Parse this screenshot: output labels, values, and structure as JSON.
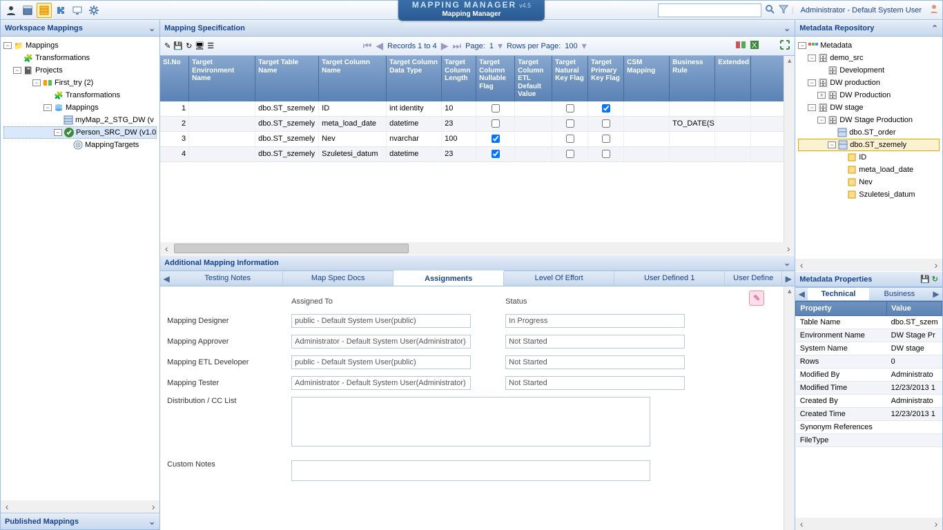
{
  "app": {
    "title_line1": "MAPPING MANAGER",
    "title_line2": "Mapping Manager",
    "version": "v4.5"
  },
  "user": {
    "label": "Administrator - Default System User"
  },
  "left": {
    "header": "Workspace Mappings",
    "footer": "Published Mappings",
    "tree": {
      "root": "Mappings",
      "transformations": "Transformations",
      "projects": "Projects",
      "first_try": "First_try (2)",
      "transformations2": "Transformations",
      "mappings2": "Mappings",
      "map1": "myMap_2_STG_DW (v",
      "map2": "Person_SRC_DW (v1.0",
      "targets": "MappingTargets"
    }
  },
  "center": {
    "header": "Mapping Specification",
    "records": "Records 1 to 4",
    "page_label": "Page:",
    "page": "1",
    "rpp_label": "Rows per Page:",
    "rpp": "100",
    "cols": {
      "slno": "Sl.No",
      "env": "Target Environment Name",
      "table": "Target Table Name",
      "column": "Target Column Name",
      "dtype": "Target Column Data Type",
      "len": "Target Column Length",
      "nullable": "Target Column Nullable Flag",
      "etldef": "Target Column ETL Default Value",
      "natkey": "Target Natural Key Flag",
      "pk": "Target Primary Key Flag",
      "csm": "CSM Mapping",
      "brule": "Business Rule",
      "ext": "Extended Business Transfor"
    },
    "rows": [
      {
        "sl": "1",
        "table": "dbo.ST_szemely",
        "col": "ID",
        "dt": "int identity",
        "len": "10",
        "null": false,
        "nat": false,
        "pk": true,
        "br": ""
      },
      {
        "sl": "2",
        "table": "dbo.ST_szemely",
        "col": "meta_load_date",
        "dt": "datetime",
        "len": "23",
        "null": false,
        "nat": false,
        "pk": false,
        "br": "TO_DATE(SY"
      },
      {
        "sl": "3",
        "table": "dbo.ST_szemely",
        "col": "Nev",
        "dt": "nvarchar",
        "len": "100",
        "null": true,
        "nat": false,
        "pk": false,
        "br": ""
      },
      {
        "sl": "4",
        "table": "dbo.ST_szemely",
        "col": "Szuletesi_datum",
        "dt": "datetime",
        "len": "23",
        "null": true,
        "nat": false,
        "pk": false,
        "br": ""
      }
    ]
  },
  "lower": {
    "header": "Additional Mapping Information",
    "tabs": {
      "testing": "Testing Notes",
      "spec": "Map Spec Docs",
      "assign": "Assignments",
      "loe": "Level Of Effort",
      "ud1": "User Defined 1",
      "udx": "User Define"
    },
    "assign": {
      "hdr1": "Assigned To",
      "hdr2": "Status",
      "rows": {
        "designer": {
          "lbl": "Mapping Designer",
          "who": "public - Default System User(public)",
          "st": "In Progress"
        },
        "approver": {
          "lbl": "Mapping Approver",
          "who": "Administrator - Default System User(Administrator)",
          "st": "Not Started"
        },
        "etl": {
          "lbl": "Mapping ETL Developer",
          "who": "public - Default System User(public)",
          "st": "Not Started"
        },
        "tester": {
          "lbl": "Mapping Tester",
          "who": "Administrator - Default System User(Administrator)",
          "st": "Not Started"
        },
        "dist": {
          "lbl": "Distribution / CC List"
        },
        "notes": {
          "lbl": "Custom Notes"
        }
      }
    }
  },
  "right": {
    "header": "Metadata Repository",
    "tree": {
      "root": "Metadata",
      "demo": "demo_src",
      "dev": "Development",
      "dwp": "DW production",
      "dwp2": "DW Production",
      "dws": "DW stage",
      "dwsp": "DW Stage Production",
      "order": "dbo.ST_order",
      "szem": "dbo.ST_szemely",
      "c1": "ID",
      "c2": "meta_load_date",
      "c3": "Nev",
      "c4": "Szuletesi_datum"
    },
    "props_header": "Metadata Properties",
    "tabs": {
      "tech": "Technical",
      "biz": "Business"
    },
    "props_cols": {
      "p": "Property",
      "v": "Value"
    },
    "props": [
      {
        "p": "Table Name",
        "v": "dbo.ST_szem"
      },
      {
        "p": "Environment Name",
        "v": "DW Stage Pr"
      },
      {
        "p": "System Name",
        "v": "DW stage"
      },
      {
        "p": "Rows",
        "v": "0"
      },
      {
        "p": "Modified By",
        "v": "Administrato"
      },
      {
        "p": "Modified Time",
        "v": "12/23/2013 1"
      },
      {
        "p": "Created By",
        "v": "Administrato"
      },
      {
        "p": "Created Time",
        "v": "12/23/2013 1"
      },
      {
        "p": "Synonym References",
        "v": ""
      },
      {
        "p": "FileType",
        "v": ""
      }
    ]
  }
}
